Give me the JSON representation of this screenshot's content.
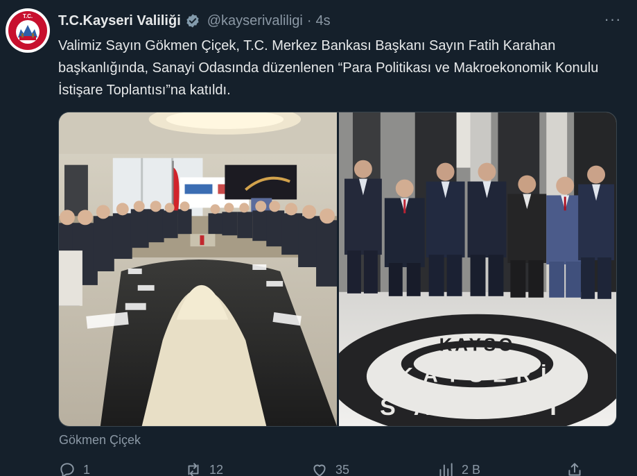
{
  "tweet": {
    "display_name": "T.C.Kayseri Valiliği",
    "handle": "@kayserivaliligi",
    "separator": "·",
    "time": "4s",
    "more_label": "···",
    "text": "Valimiz Sayın Gökmen Çiçek, T.C. Merkez Bankası Başkanı Sayın Fatih Karahan başkanlığında, Sanayi Odasında düzenlenen “Para Politikası ve Makroekonomik Konulu İstişare Toplantısı”na katıldı.",
    "media_caption": "Gökmen Çiçek",
    "floor_logo": {
      "inner": "KAYSO",
      "outer_top": "KAYSERİ",
      "outer_bottom": "SANAYİ"
    },
    "actions": {
      "replies": "1",
      "retweets": "12",
      "likes": "35",
      "views": "2 B"
    }
  },
  "avatar_text": "T.C.",
  "colors": {
    "background": "#15202b",
    "secondary_text": "#8b98a5",
    "verified": "#829aab",
    "avatar_red": "#c8102e"
  },
  "icons": [
    "verified-badge-icon",
    "more-icon",
    "reply-icon",
    "retweet-icon",
    "like-icon",
    "views-icon",
    "share-icon"
  ]
}
